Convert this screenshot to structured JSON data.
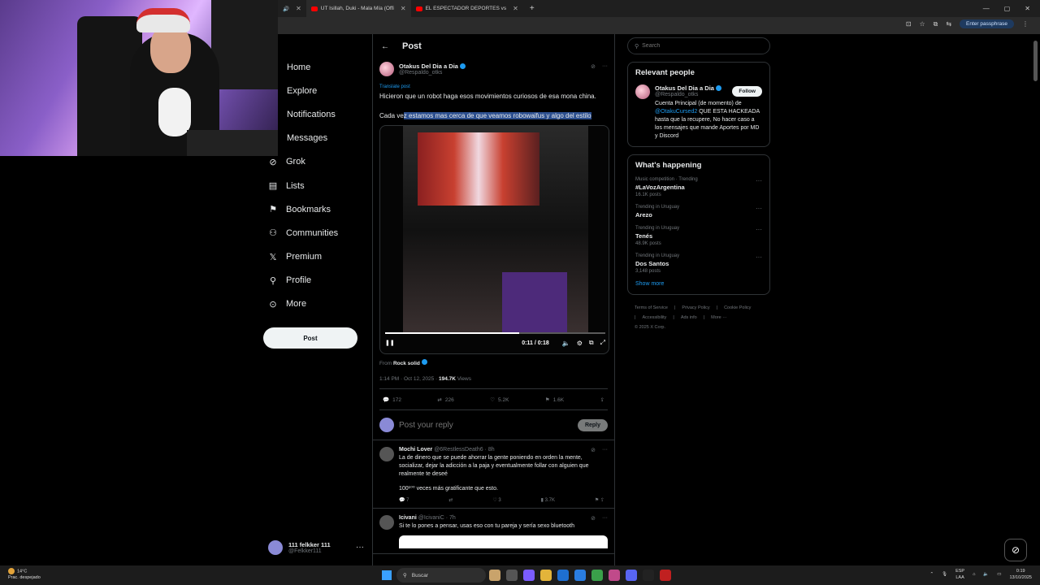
{
  "browser": {
    "tabs": [
      {
        "label": "UT Isillah, Duki - Mala Mía (Offi"
      },
      {
        "label": "EL ESPECTADOR DEPORTES vs"
      }
    ],
    "passphrase_label": "Enter passphrase"
  },
  "sidebar": {
    "items": [
      {
        "label": "Home",
        "icon": "home-icon"
      },
      {
        "label": "Explore",
        "icon": "search-icon"
      },
      {
        "label": "Notifications",
        "icon": "bell-icon"
      },
      {
        "label": "Messages",
        "icon": "mail-icon"
      },
      {
        "label": "Grok",
        "icon": "grok-icon"
      },
      {
        "label": "Lists",
        "icon": "list-icon"
      },
      {
        "label": "Bookmarks",
        "icon": "bookmark-icon"
      },
      {
        "label": "Communities",
        "icon": "people-icon"
      },
      {
        "label": "Premium",
        "icon": "x-logo-icon"
      },
      {
        "label": "Profile",
        "icon": "person-icon"
      },
      {
        "label": "More",
        "icon": "more-circle-icon"
      }
    ],
    "post_label": "Post",
    "account": {
      "name": "111 felkker 111",
      "handle": "@Felkker111"
    }
  },
  "main": {
    "header_title": "Post",
    "post": {
      "author_name": "Otakus Del Dia a Dia",
      "author_handle": "@Respaldo_otks",
      "translate": "Translate post",
      "text1": "Hicieron que un robot haga esos movimientos curiosos de esa mona china.",
      "text2_prefix": "Cada ve",
      "text2_highlight": "z estamos mas cerca de que veamos robowaifus y algo del estilo",
      "video": {
        "time": "0:11 / 0:18",
        "progress": 0.61
      },
      "from_prefix": "From",
      "from_name": "Rock solid",
      "meta_time": "1:14 PM · Oct 12, 2025 · ",
      "views_count": "194.7K",
      "views_label": "Views",
      "replies": "172",
      "reposts": "226",
      "likes": "5.2K",
      "bookmarks": "1.6K"
    },
    "reply": {
      "placeholder": "Post your reply",
      "button": "Reply"
    },
    "comments": [
      {
        "name": "Mochi Lover",
        "handle": "@6RestlessDeath6 · 8h",
        "text": "La de dinero que se puede ahorrar la gente poniendo en orden la mente, socializar, dejar la adicción a la paja y eventualmente follar con alguien que realmente te deseé",
        "text2": "100¹⁰⁰ veces más gratificante que esto.",
        "replies": "7",
        "reposts": "",
        "likes": "3",
        "views": "3.7K"
      },
      {
        "name": "Icivani",
        "handle": "@IcivaniC · 7h",
        "text": "Si te lo pones a pensar, usas eso con tu pareja y sería sexo bluetooth"
      }
    ]
  },
  "right": {
    "search_placeholder": "Search",
    "relevant_title": "Relevant people",
    "person": {
      "name": "Otakus Del Dia a Dia",
      "handle": "@Respaldo_otks",
      "follow": "Follow",
      "bio_prefix": "Cuenta Principal (de momento) de",
      "bio_mention": "@OtakuCursed2",
      "bio_suffix": "QUE ESTA HACKEADA hasta que la recupere, No hacer caso a los mensajes que mande Aportes por MD y Discord"
    },
    "happening_title": "What's happening",
    "trends": [
      {
        "context": "Music competition · Trending",
        "title": "#LaVozArgentina",
        "count": "16.1K posts"
      },
      {
        "context": "Trending in Uruguay",
        "title": "Arezo",
        "count": ""
      },
      {
        "context": "Trending in Uruguay",
        "title": "Tenés",
        "count": "48.9K posts"
      },
      {
        "context": "Trending in Uruguay",
        "title": "Dos Santos",
        "count": "3,148 posts"
      }
    ],
    "show_more": "Show more",
    "footer": [
      "Terms of Service",
      "|",
      "Privacy Policy",
      "|",
      "Cookie Policy",
      "|",
      "Accessibility",
      "|",
      "Ads info",
      "|",
      "More ···",
      "© 2025 X Corp."
    ]
  },
  "taskbar": {
    "temp": "14°C",
    "weather": "Prac. despejado",
    "search": "Buscar",
    "lang1": "ESP",
    "lang2": "LAA",
    "time": "0:19",
    "date": "13/10/2025"
  },
  "colors": {
    "accent": "#1d9bf0",
    "background": "#000000",
    "highlight": "#2c4f8f"
  }
}
